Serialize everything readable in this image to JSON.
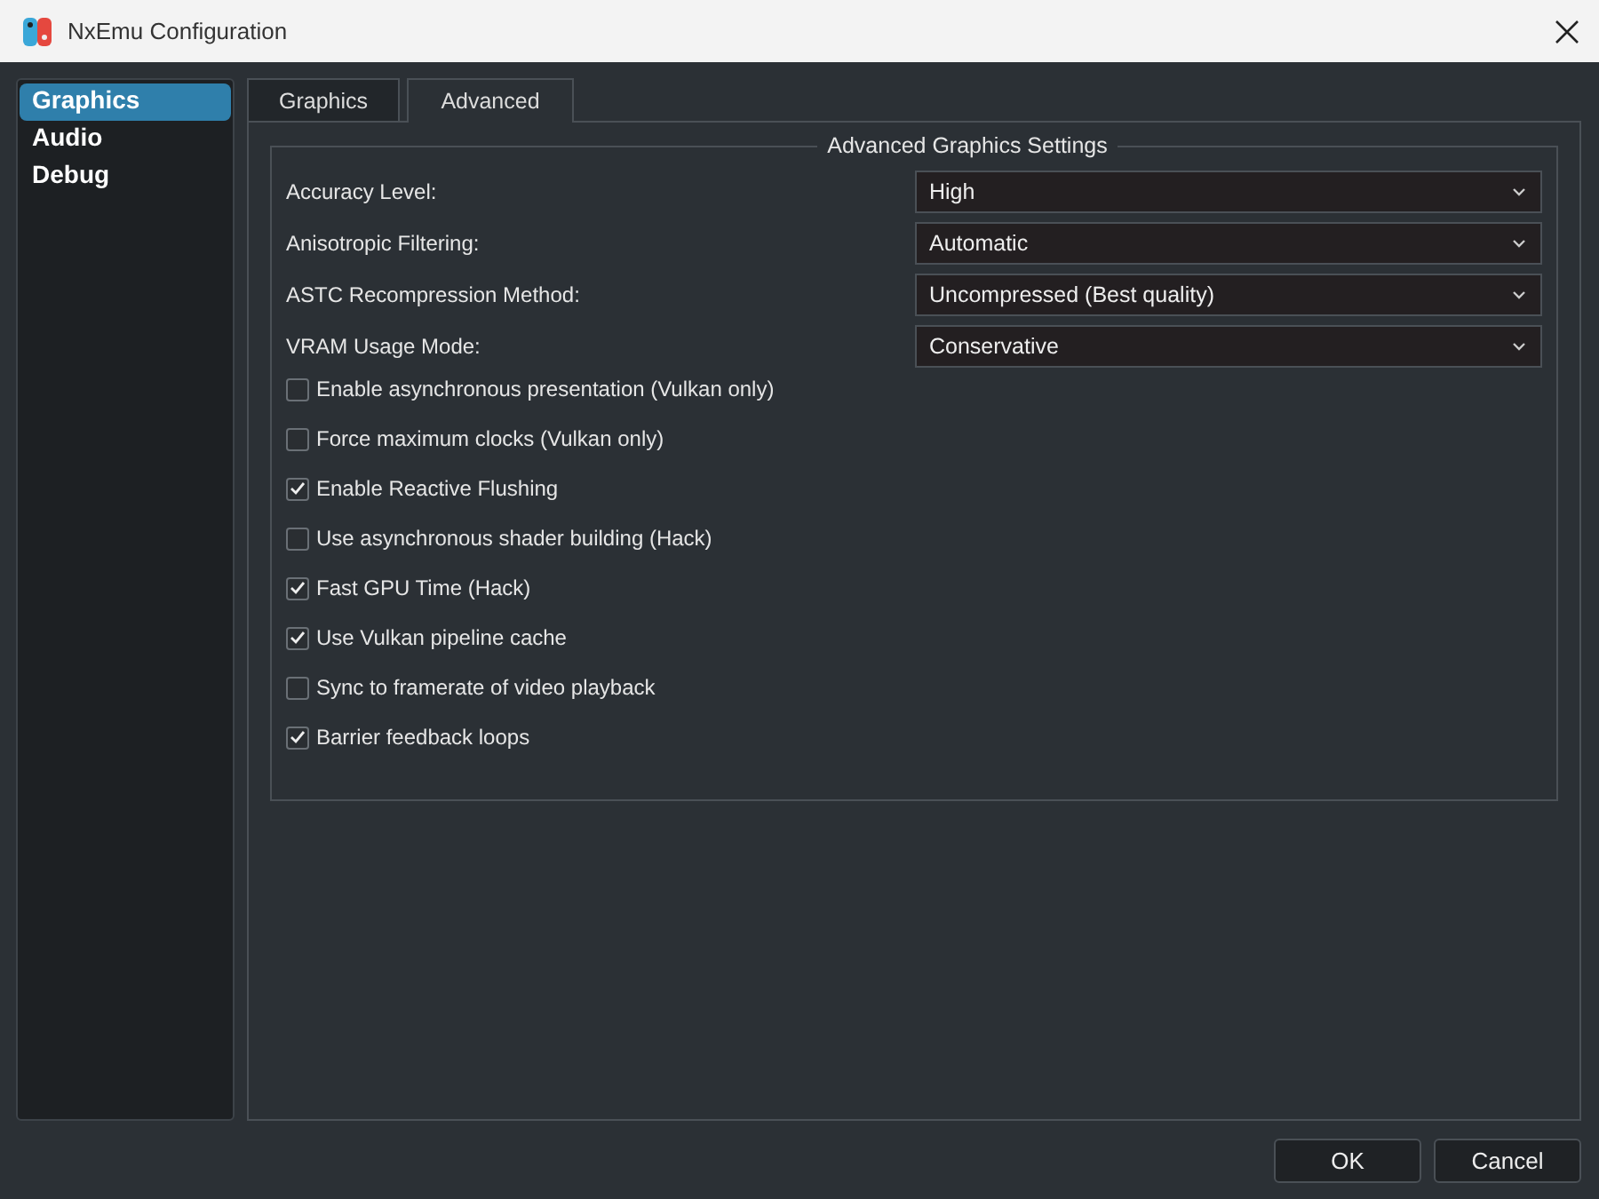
{
  "window": {
    "title": "NxEmu Configuration"
  },
  "sidebar": {
    "items": [
      {
        "label": "Graphics",
        "selected": true
      },
      {
        "label": "Audio",
        "selected": false
      },
      {
        "label": "Debug",
        "selected": false
      }
    ]
  },
  "tabs": [
    {
      "label": "Graphics",
      "selected": false
    },
    {
      "label": "Advanced",
      "selected": true
    }
  ],
  "group": {
    "title": "Advanced Graphics Settings",
    "settings": [
      {
        "label": "Accuracy Level:",
        "value": "High"
      },
      {
        "label": "Anisotropic Filtering:",
        "value": "Automatic"
      },
      {
        "label": "ASTC Recompression Method:",
        "value": "Uncompressed (Best quality)"
      },
      {
        "label": "VRAM Usage Mode:",
        "value": "Conservative"
      }
    ],
    "options": [
      {
        "label": "Enable asynchronous presentation (Vulkan only)",
        "checked": false
      },
      {
        "label": "Force maximum clocks (Vulkan only)",
        "checked": false
      },
      {
        "label": "Enable Reactive Flushing",
        "checked": true
      },
      {
        "label": "Use asynchronous shader building (Hack)",
        "checked": false
      },
      {
        "label": "Fast GPU Time (Hack)",
        "checked": true
      },
      {
        "label": "Use Vulkan pipeline cache",
        "checked": true
      },
      {
        "label": "Sync to framerate of video playback",
        "checked": false
      },
      {
        "label": "Barrier feedback loops",
        "checked": true
      }
    ]
  },
  "buttons": [
    "OK",
    "Cancel"
  ]
}
